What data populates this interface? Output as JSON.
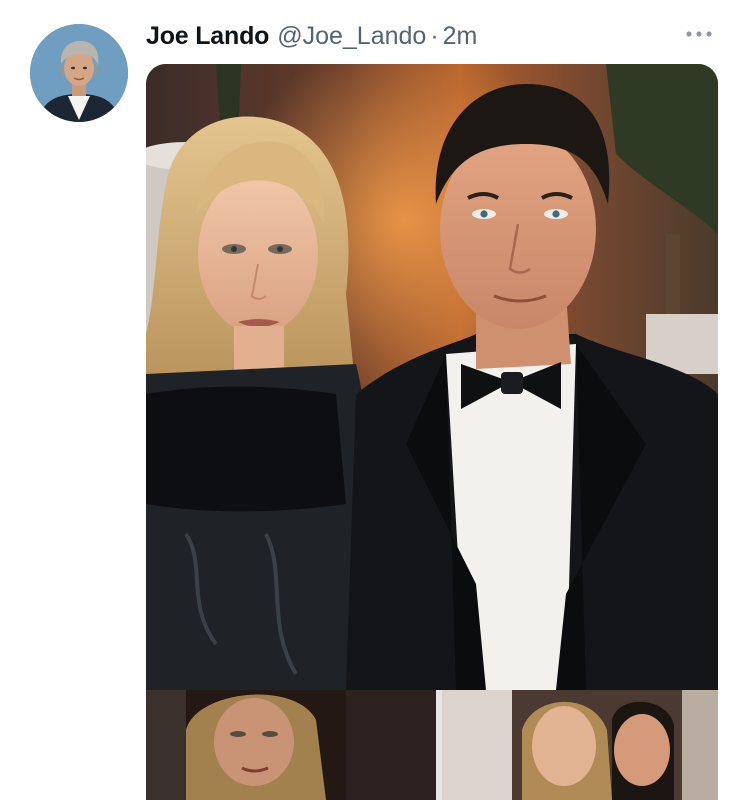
{
  "tweet": {
    "display_name": "Joe Lando",
    "handle": "@Joe_Lando",
    "separator": "·",
    "timestamp": "2m"
  },
  "icons": {
    "avatar": "profile-photo",
    "more": "more-horizontal-icon"
  },
  "media": {
    "main_photo": "photo of a man in a black tuxedo with bow tie next to a blonde woman in a dark dress",
    "thumbnails": [
      "thumbnail-left",
      "thumbnail-right"
    ]
  },
  "colors": {
    "name": "#0f1419",
    "secondary": "#536471",
    "background": "#ffffff"
  }
}
